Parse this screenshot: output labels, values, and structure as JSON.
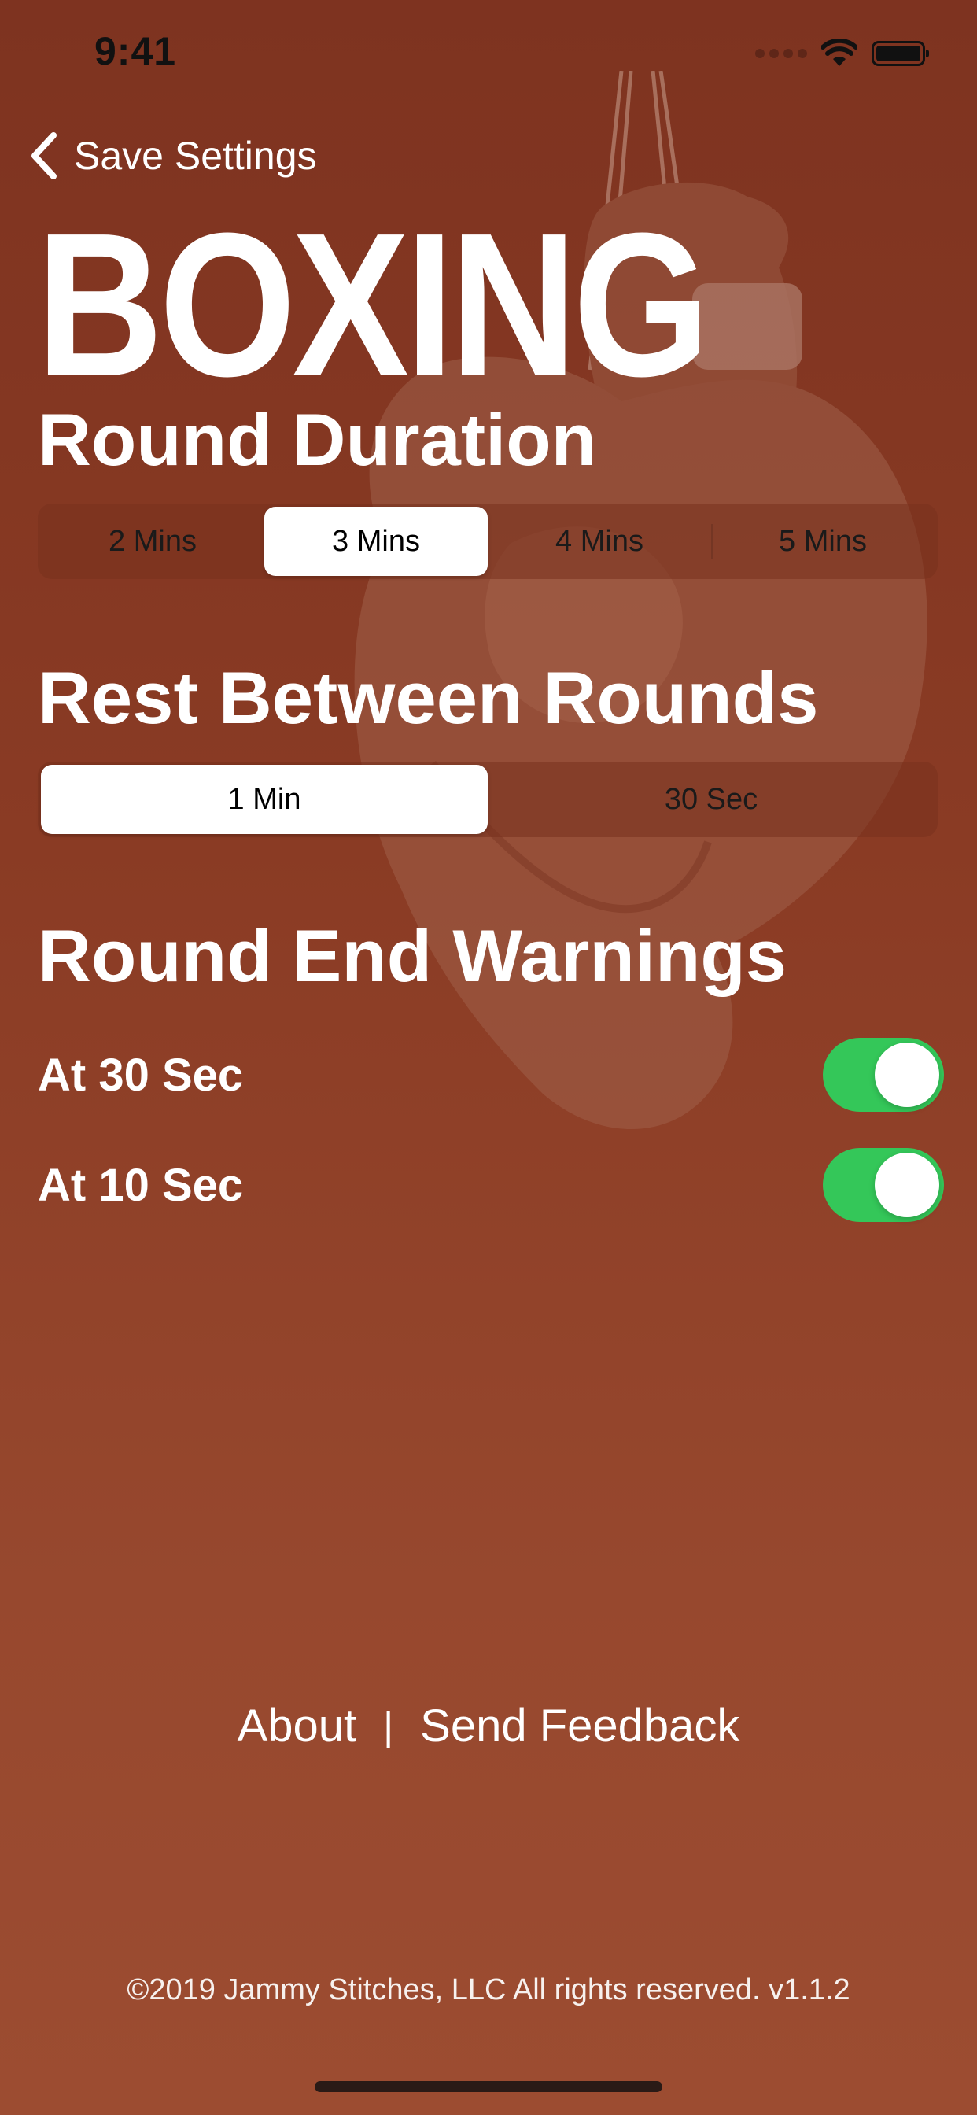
{
  "status_bar": {
    "time": "9:41"
  },
  "nav": {
    "back_label": "Save Settings",
    "back_icon": "chevron-left-icon"
  },
  "app": {
    "title": "BOXING"
  },
  "round_duration": {
    "heading": "Round Duration",
    "options": [
      "2 Mins",
      "3 Mins",
      "4 Mins",
      "5 Mins"
    ],
    "selected": "3 Mins"
  },
  "rest_between_rounds": {
    "heading": "Rest Between Rounds",
    "options": [
      "1 Min",
      "30 Sec"
    ],
    "selected": "1 Min"
  },
  "round_end_warnings": {
    "heading": "Round End Warnings",
    "toggles": [
      {
        "label": "At 30 Sec",
        "on": true
      },
      {
        "label": "At 10 Sec",
        "on": true
      }
    ]
  },
  "footer": {
    "about_label": "About",
    "separator": "|",
    "feedback_label": "Send Feedback",
    "copyright": "©2019 Jammy Stitches, LLC All rights reserved. v1.1.2"
  },
  "colors": {
    "background_top": "#7e3320",
    "background_bottom": "#9c4c31",
    "switch_on": "#34c759",
    "segment_selected": "#ffffff"
  }
}
